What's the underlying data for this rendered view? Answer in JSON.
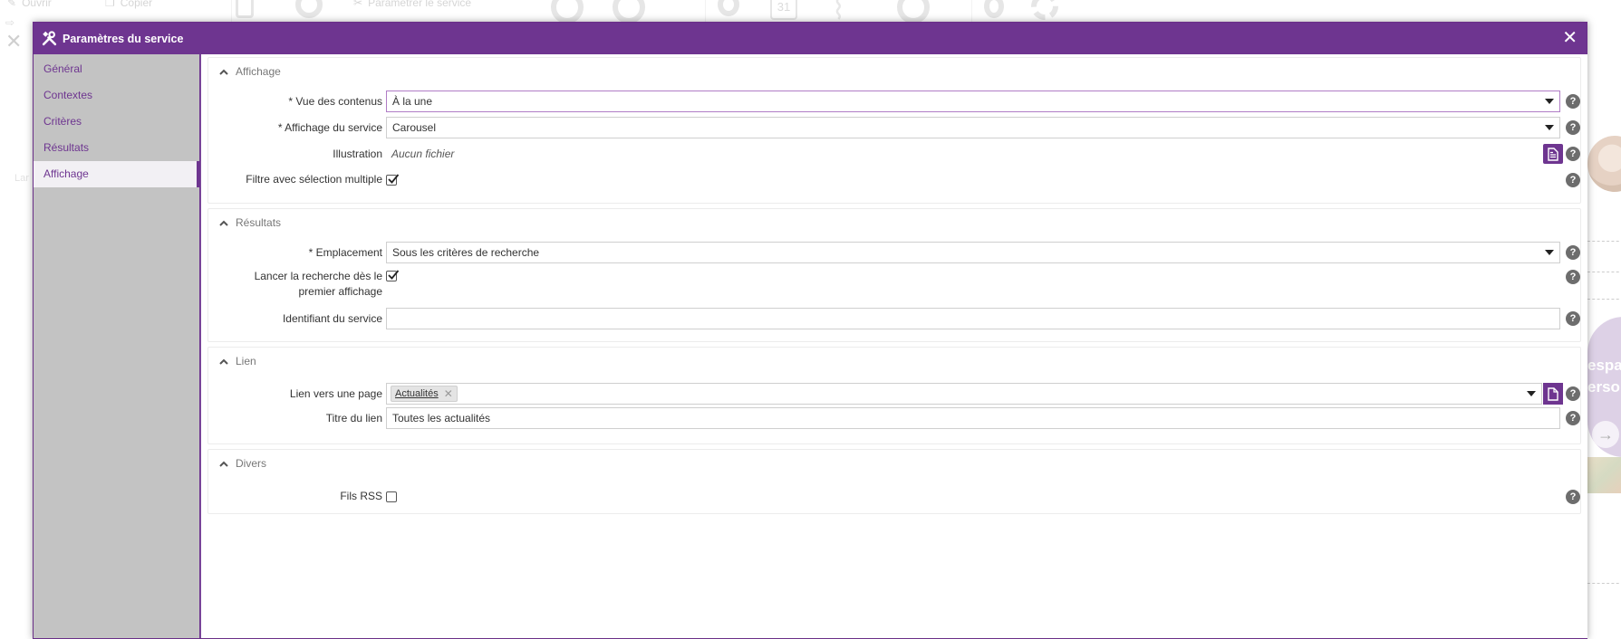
{
  "background": {
    "toolbar_items": [
      "Ouvrir",
      "Copier",
      "Paramétrer le service"
    ],
    "lang_label": "Lar",
    "promo_text": [
      "espa",
      "erso"
    ],
    "calendar_day": "31"
  },
  "dialog": {
    "title": "Paramètres du service",
    "close_symbol": "✕"
  },
  "sidebar": {
    "items": [
      {
        "label": "Général",
        "active": false
      },
      {
        "label": "Contextes",
        "active": false
      },
      {
        "label": "Critères",
        "active": false
      },
      {
        "label": "Résultats",
        "active": false
      },
      {
        "label": "Affichage",
        "active": true
      }
    ]
  },
  "sections": {
    "affichage": {
      "title": "Affichage",
      "vue_label": "* Vue des contenus",
      "vue_value": "À la une",
      "affichage_label": "* Affichage du service",
      "affichage_value": "Carousel",
      "illustration_label": "Illustration",
      "illustration_value": "Aucun fichier",
      "filtre_label": "Filtre avec sélection multiple",
      "filtre_checked": true
    },
    "resultats": {
      "title": "Résultats",
      "emplacement_label": "* Emplacement",
      "emplacement_value": "Sous les critères de recherche",
      "lancer_label_line1": "Lancer la recherche dès le",
      "lancer_label_line2": "premier affichage",
      "lancer_checked": true,
      "identifiant_label": "Identifiant du service",
      "identifiant_value": ""
    },
    "lien": {
      "title": "Lien",
      "lien_label": "Lien vers une page",
      "lien_tag": "Actualités",
      "titre_label": "Titre du lien",
      "titre_value": "Toutes les actualités"
    },
    "divers": {
      "title": "Divers",
      "rss_label": "Fils RSS",
      "rss_checked": false
    }
  },
  "help_symbol": "?",
  "colors": {
    "brand": "#6e3590",
    "sidebar_bg": "#c3c3c3",
    "help_bg": "#6d6d6d"
  }
}
